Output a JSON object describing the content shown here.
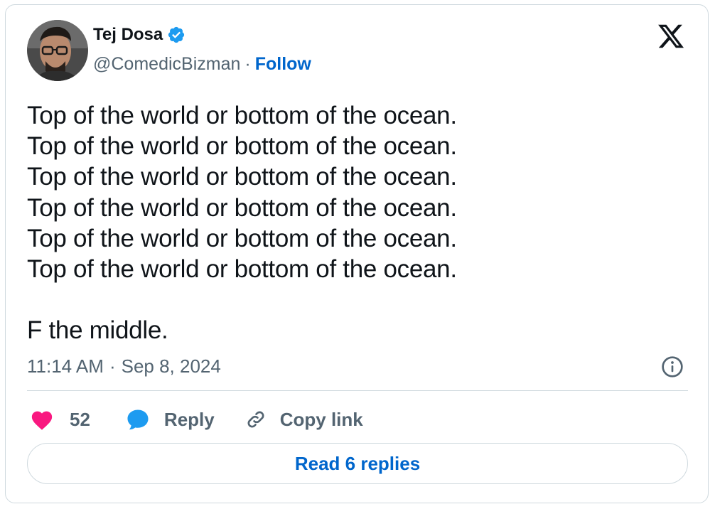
{
  "author": {
    "name": "Tej Dosa",
    "handle": "@ComedicBizman",
    "separator": "·",
    "follow_label": "Follow"
  },
  "tweet": {
    "lines": [
      "Top of the world or bottom of the ocean.",
      "Top of the world or bottom of the ocean.",
      "Top of the world or bottom of the ocean.",
      "Top of the world or bottom of the ocean.",
      "Top of the world or bottom of the ocean.",
      "Top of the world or bottom of the ocean."
    ],
    "closing_line": "F the middle.",
    "time": "11:14 AM",
    "date_separator": "·",
    "date": "Sep 8, 2024"
  },
  "actions": {
    "like_count": "52",
    "reply_label": "Reply",
    "copy_link_label": "Copy link",
    "read_replies_label": "Read 6 replies"
  },
  "icons": {
    "verified": "verified-badge-icon",
    "brand": "x-logo-icon",
    "info": "info-icon",
    "like": "heart-icon",
    "reply": "speech-bubble-icon",
    "copy": "link-icon"
  },
  "colors": {
    "text": "#0f1419",
    "secondary": "#536471",
    "link": "#0066cc",
    "like": "#f91880",
    "reply": "#1d9bf0",
    "verified": "#1d9bf0",
    "border": "#cfd9de"
  }
}
